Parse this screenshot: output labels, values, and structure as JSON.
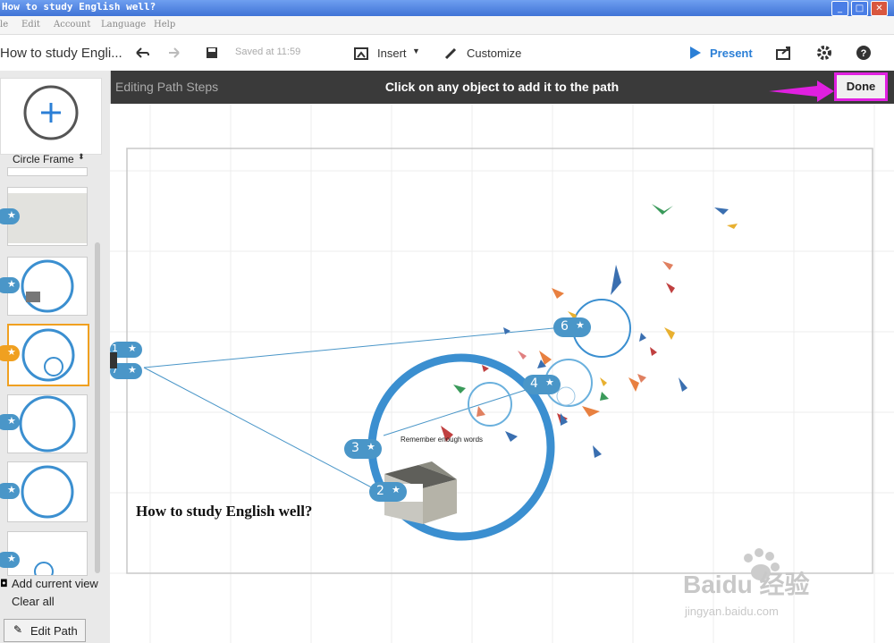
{
  "window": {
    "title": "How to study English well?"
  },
  "menu": {
    "items": [
      "le",
      "Edit",
      "Account",
      "Language",
      "Help"
    ]
  },
  "toolbar": {
    "doc_title": "How to study Engli...",
    "saved": "Saved at 11:59",
    "insert_label": "Insert",
    "customize_label": "Customize",
    "present_label": "Present"
  },
  "path_bar": {
    "left_label": "Editing Path Steps",
    "instruction": "Click on any object to add it to the path",
    "done_label": "Done"
  },
  "sidebar": {
    "frame_type": "Circle Frame",
    "add_view": "Add current view",
    "clear_all": "Clear all",
    "edit_path": "Edit Path",
    "thumb_badges": [
      "",
      "",
      "",
      "",
      "",
      ""
    ]
  },
  "canvas": {
    "title_text": "How to study English well?",
    "remember_text": "Remember enough words",
    "step_numbers": [
      "1",
      "7",
      "3",
      "2",
      "4",
      "6"
    ]
  },
  "watermark": {
    "brand": "Baidu 经验",
    "url": "jingyan.baidu.com"
  },
  "colors": {
    "accent": "#4a96c8",
    "highlight": "#e020e0",
    "circle": "#3b8fd0"
  }
}
